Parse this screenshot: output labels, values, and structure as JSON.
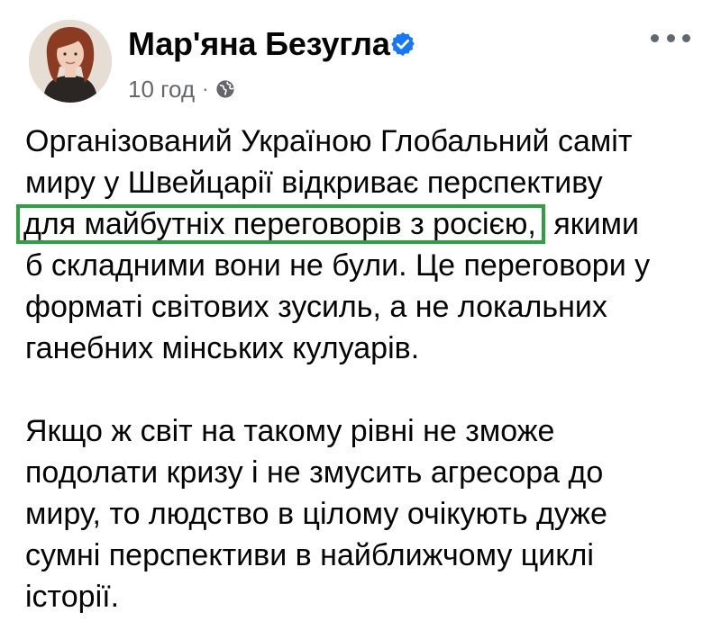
{
  "author": {
    "name": "Мар'яна Безугла",
    "verified": true,
    "verified_icon": "verified-badge-icon",
    "avatar_icon": "avatar"
  },
  "meta": {
    "time": "10 год",
    "separator": "·",
    "audience_icon": "globe-icon"
  },
  "menu": {
    "more_icon": "more-options-icon"
  },
  "colors": {
    "text": "#050505",
    "meta": "#65676b",
    "verified": "#1877f2",
    "highlight_border": "#2ea043"
  },
  "post": {
    "p1": {
      "line1": "Організований Україною Глобальний саміт",
      "line2": "миру у Швейцарії відкриває перспективу",
      "line3_highlight": "для майбутніх переговорів з росією,",
      "line3_rest": "якими",
      "line4": "б складними вони не були. Це переговори у",
      "line5": "форматі світових зусиль, а не локальних",
      "line6": "ганебних мінських кулуарів."
    },
    "p2": {
      "line1": "Якщо ж світ на такому рівні не зможе",
      "line2": "подолати кризу і не змусить агресора до",
      "line3": "миру, то людство в цілому очікують дуже",
      "line4": "сумні перспективи в найближчому циклі",
      "line5": "історії."
    }
  }
}
